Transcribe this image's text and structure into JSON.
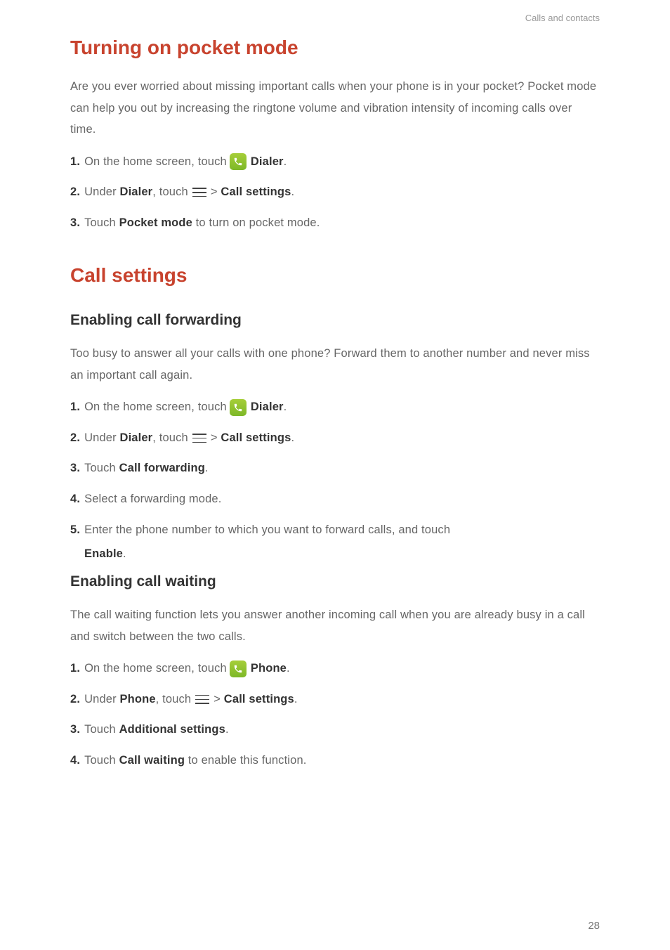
{
  "header": {
    "section": "Calls and contacts"
  },
  "h1_1": "Turning on pocket mode",
  "intro_1": "Are you ever worried about missing important calls when your phone is in your pocket? Pocket mode can help you out by increasing the ringtone volume and vibration intensity of incoming calls over time.",
  "s1": {
    "n1": "1.",
    "t1a": "On the home screen, touch",
    "t1b": "Dialer",
    "t1c": ".",
    "n2": "2.",
    "t2a": "Under",
    "t2b": "Dialer",
    "t2c": ", touch",
    "t2d": ">",
    "t2e": "Call settings",
    "t2f": ".",
    "n3": "3.",
    "t3a": "Touch",
    "t3b": "Pocket mode",
    "t3c": "to turn on pocket mode."
  },
  "h1_2": "Call settings",
  "h2_1": "Enabling call forwarding",
  "intro_2": "Too busy to answer all your calls with one phone? Forward them to another number and never miss an important call again.",
  "s2": {
    "n1": "1.",
    "t1a": "On the home screen, touch",
    "t1b": "Dialer",
    "t1c": ".",
    "n2": "2.",
    "t2a": "Under",
    "t2b": "Dialer",
    "t2c": ", touch",
    "t2d": ">",
    "t2e": "Call settings",
    "t2f": ".",
    "n3": "3.",
    "t3a": "Touch",
    "t3b": "Call forwarding",
    "t3c": ".",
    "n4": "4.",
    "t4a": "Select a forwarding mode.",
    "n5": "5.",
    "t5a": "Enter the phone number to which you want to forward calls, and touch",
    "t5b": "Enable",
    "t5c": "."
  },
  "h2_2": "Enabling call waiting",
  "intro_3": "The call waiting function lets you answer another incoming call when you are already busy in a call and switch between the two calls.",
  "s3": {
    "n1": "1.",
    "t1a": "On the home screen, touch",
    "t1b": "Phone",
    "t1c": ".",
    "n2": "2.",
    "t2a": "Under",
    "t2b": "Phone",
    "t2c": ", touch",
    "t2d": ">",
    "t2e": "Call settings",
    "t2f": ".",
    "n3": "3.",
    "t3a": "Touch",
    "t3b": "Additional settings",
    "t3c": ".",
    "n4": "4.",
    "t4a": "Touch",
    "t4b": "Call waiting",
    "t4c": "to enable this function."
  },
  "page": "28"
}
